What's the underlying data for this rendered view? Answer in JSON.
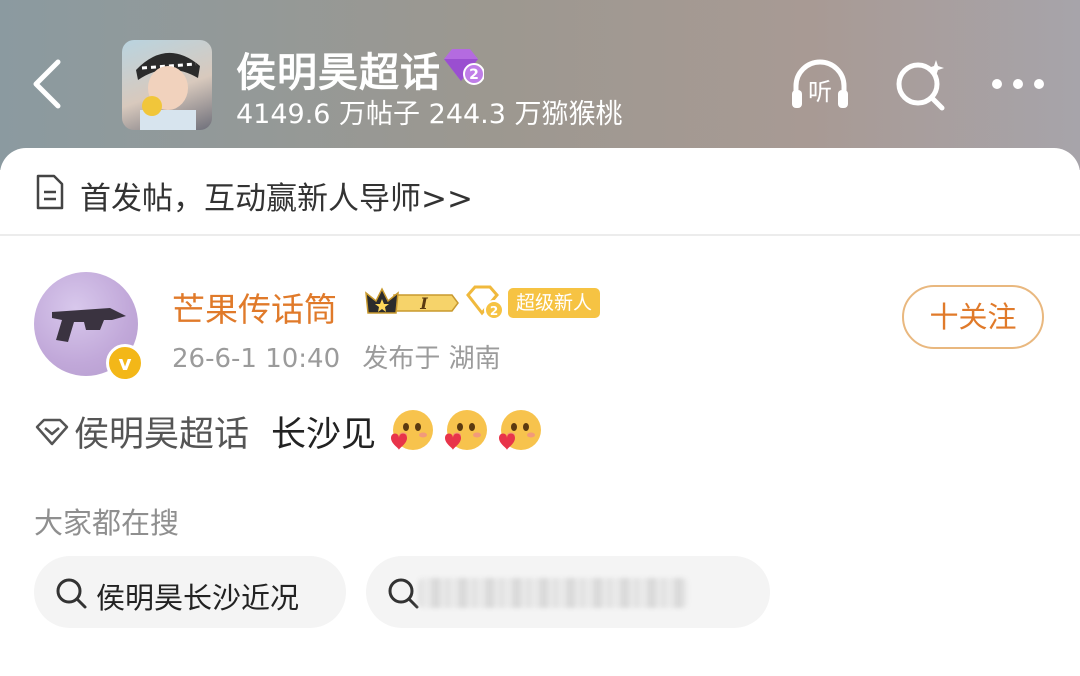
{
  "header": {
    "title": "侯明昊超话",
    "level_badge": "2",
    "stats": "4149.6 万帖子 244.3 万猕猴桃",
    "listen_label": "听"
  },
  "notice": {
    "text": "首发帖，互动赢新人导师>>"
  },
  "post": {
    "username": "芒果传话筒",
    "verified_mark": "v",
    "level_label": "I",
    "diamond_level": "2",
    "newbie_badge": "超级新人",
    "time": "26-6-1 10:40",
    "location": "发布于 湖南",
    "follow_label": "十关注",
    "topic": "侯明昊超话",
    "text": "长沙见"
  },
  "search": {
    "label": "大家都在搜",
    "chips": [
      "侯明昊长沙近况"
    ]
  },
  "colors": {
    "accent_orange": "#e07a2a",
    "follow_border": "#e9b87f",
    "badge_gold": "#f6c343",
    "verified_gold": "#f3b718"
  },
  "icons": [
    "back-arrow-icon",
    "listen-icon",
    "search-sparkle-icon",
    "more-icon",
    "document-icon",
    "crown-icon",
    "diamond-icon",
    "topic-diamond-icon",
    "heart-emoji-icon",
    "search-icon"
  ]
}
